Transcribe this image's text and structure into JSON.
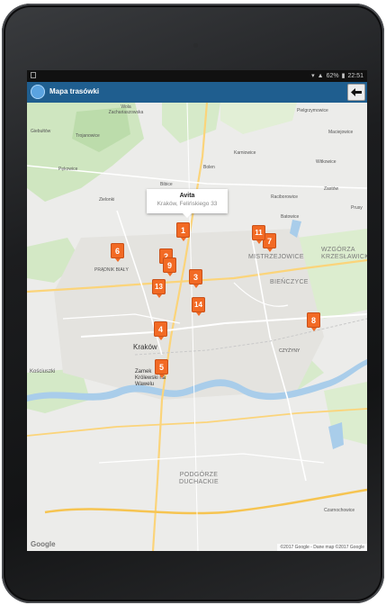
{
  "status": {
    "battery": "62%",
    "time": "22:51"
  },
  "app": {
    "title": "Mapa trasówki",
    "back_icon": "arrow-left-icon"
  },
  "infowindow": {
    "title": "Avita",
    "address": "Kraków, Felińskiego 33"
  },
  "places": {
    "wola": "Wola Zachariaszowska",
    "pielgrzymowice": "Pielgrzymowice",
    "giebultow": "Giebułtów",
    "trojanowice": "Trojanowice",
    "maciejowice": "Maciejowice",
    "karniowice": "Karniowice",
    "pekowice": "Pękowice",
    "witkowice": "Witkowice",
    "bolen": "Bolen",
    "bibice": "Bibice",
    "zielonki": "Zielonki",
    "zastow": "Zastów",
    "raciborowice": "Raciborowice",
    "prusy": "Prusy",
    "batowice": "Batowice",
    "pradnik": "PRĄDNIK BIAŁY",
    "mistrzejowice": "MISTRZEJOWICE",
    "wzgorza": "WZGÓRZA KRZESŁAWICKIE",
    "bienczyce": "BIEŃCZYCE",
    "krakow": "Kraków",
    "kosciuszki": "Kościuszki",
    "zamek": "Zamek Królewski na Wawelu",
    "czyzyny": "CZYŻYNY",
    "podgorze": "PODGÓRZE DUCHACKIE",
    "czarnochowice": "Czarnochowice",
    "google": "Google",
    "attribution": "©2017 Google - Dane map ©2017 Google"
  },
  "markers": [
    {
      "label": "1"
    },
    {
      "label": "2"
    },
    {
      "label": "3"
    },
    {
      "label": "4"
    },
    {
      "label": "5"
    },
    {
      "label": "6"
    },
    {
      "label": "7"
    },
    {
      "label": "8"
    },
    {
      "label": "9"
    },
    {
      "label": "11"
    },
    {
      "label": "13"
    },
    {
      "label": "14"
    }
  ],
  "colors": {
    "marker": "#f26a24",
    "appbar": "#1f5e8f"
  }
}
